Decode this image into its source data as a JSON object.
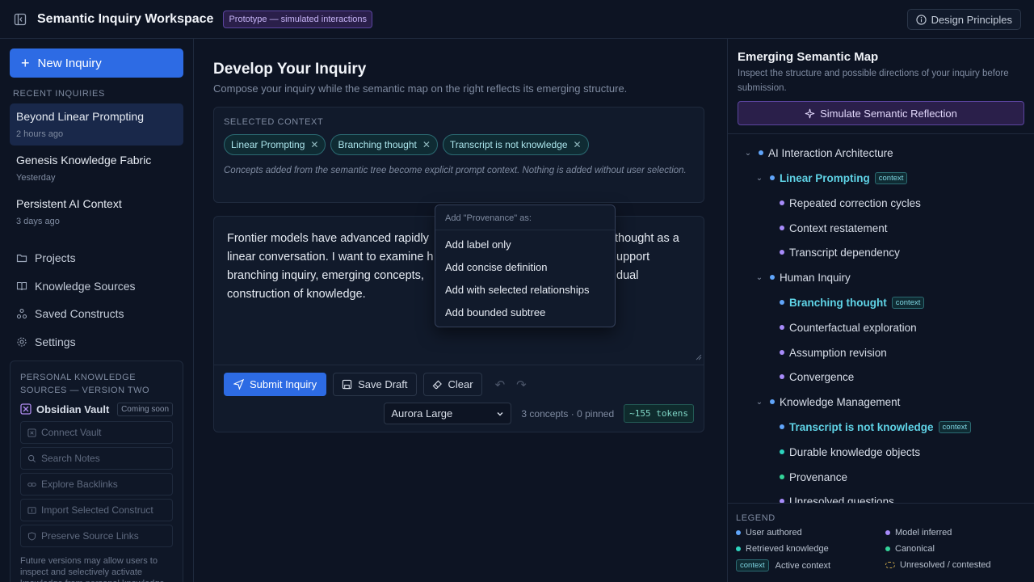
{
  "header": {
    "title": "Semantic Inquiry Workspace",
    "badge": "Prototype — simulated interactions",
    "design_button": "Design Principles"
  },
  "sidebar": {
    "new_button": "New Inquiry",
    "recent_label": "RECENT INQUIRIES",
    "recent": [
      {
        "title": "Beyond Linear Prompting",
        "time": "2 hours ago"
      },
      {
        "title": "Genesis Knowledge Fabric",
        "time": "Yesterday"
      },
      {
        "title": "Persistent AI Context",
        "time": "3 days ago"
      }
    ],
    "nav": [
      {
        "label": "Projects",
        "icon": "folder-icon"
      },
      {
        "label": "Knowledge Sources",
        "icon": "book-icon"
      },
      {
        "label": "Saved Constructs",
        "icon": "network-icon"
      },
      {
        "label": "Settings",
        "icon": "gear-icon"
      }
    ],
    "pks": {
      "title": "PERSONAL KNOWLEDGE SOURCES — VERSION TWO",
      "vault_name": "Obsidian Vault",
      "vault_badge": "Coming soon",
      "buttons": [
        "Connect Vault",
        "Search Notes",
        "Explore Backlinks",
        "Import Selected Construct",
        "Preserve Source Links"
      ],
      "note": "Future versions may allow users to inspect and selectively activate knowledge from personal knowledge"
    }
  },
  "main": {
    "title": "Develop Your Inquiry",
    "subtitle": "Compose your inquiry while the semantic map on the right reflects its emerging structure.",
    "context_label": "SELECTED CONTEXT",
    "chips": [
      "Linear Prompting",
      "Branching thought",
      "Transcript is not knowledge"
    ],
    "context_note": "Concepts added from the semantic tree become explicit prompt context. Nothing is added without user selection.",
    "editor_lines": [
      "Frontier models have advanced rapidly",
      "thought as a",
      "linear conversation. I want to examine h",
      "upport",
      "branching inquiry, emerging concepts,",
      "dual",
      "construction of knowledge."
    ],
    "submit": "Submit Inquiry",
    "save": "Save Draft",
    "clear": "Clear",
    "model": "Aurora Large",
    "meta": "3 concepts · 0 pinned",
    "tokens": "~155 tokens"
  },
  "popup": {
    "header": "Add \"Provenance\" as:",
    "items": [
      "Add label only",
      "Add concise definition",
      "Add with selected relationships",
      "Add bounded subtree"
    ]
  },
  "right": {
    "title": "Emerging Semantic Map",
    "subtitle": "Inspect the structure and possible directions of your inquiry before submission.",
    "simulate": "Simulate Semantic Reflection",
    "context_tag": "context",
    "tree": [
      {
        "label": "AI Interaction Architecture",
        "color": "#60a5fa"
      },
      {
        "label": "Linear Prompting",
        "color": "#60a5fa"
      },
      {
        "label": "Repeated correction cycles",
        "color": "#a78bfa"
      },
      {
        "label": "Context restatement",
        "color": "#a78bfa"
      },
      {
        "label": "Transcript dependency",
        "color": "#a78bfa"
      },
      {
        "label": "Human Inquiry",
        "color": "#60a5fa"
      },
      {
        "label": "Branching thought",
        "color": "#60a5fa"
      },
      {
        "label": "Counterfactual exploration",
        "color": "#a78bfa"
      },
      {
        "label": "Assumption revision",
        "color": "#a78bfa"
      },
      {
        "label": "Convergence",
        "color": "#a78bfa"
      },
      {
        "label": "Knowledge Management",
        "color": "#60a5fa"
      },
      {
        "label": "Transcript is not knowledge",
        "color": "#60a5fa"
      },
      {
        "label": "Durable knowledge objects",
        "color": "#2dd4bf"
      },
      {
        "label": "Provenance",
        "color": "#34d399"
      },
      {
        "label": "Unresolved questions",
        "color": "#a78bfa"
      }
    ],
    "legend_title": "LEGEND",
    "legend": {
      "user": "User authored",
      "model": "Model inferred",
      "retrieved": "Retrieved knowledge",
      "canonical": "Canonical",
      "context_tag": "context",
      "active": "Active context",
      "unresolved": "Unresolved / contested"
    },
    "colors": {
      "user": "#60a5fa",
      "model": "#a78bfa",
      "retrieved": "#2dd4bf",
      "canonical": "#34d399"
    }
  }
}
